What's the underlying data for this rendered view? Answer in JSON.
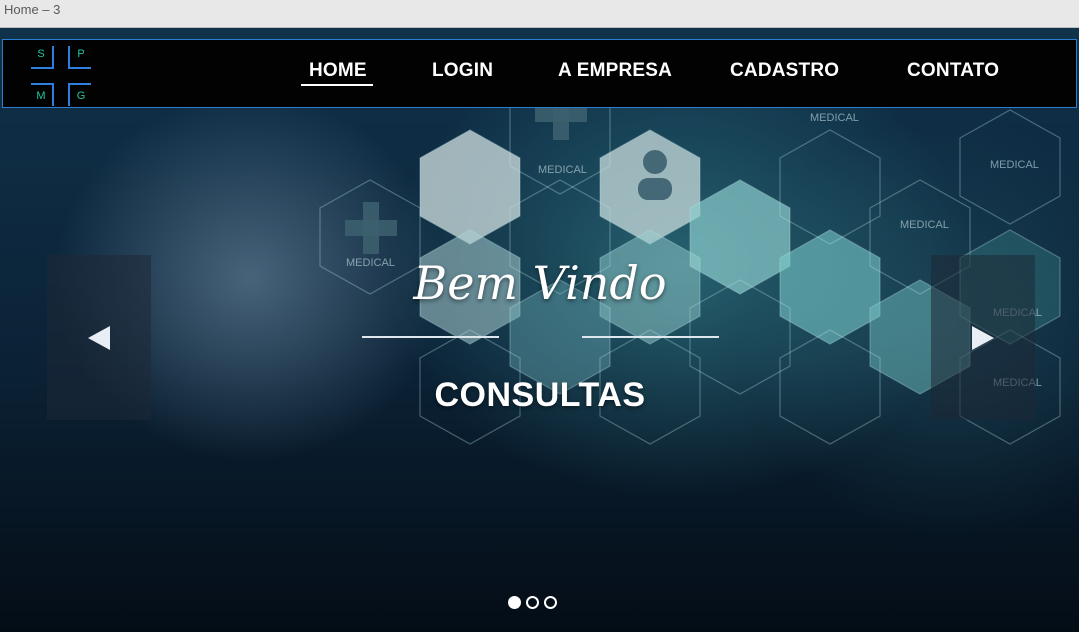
{
  "window": {
    "title": "Home – 3"
  },
  "logo": {
    "letters": [
      "S",
      "P",
      "M",
      "G"
    ]
  },
  "nav": {
    "items": [
      {
        "label": "HOME",
        "active": true
      },
      {
        "label": "LOGIN",
        "active": false
      },
      {
        "label": "A EMPRESA",
        "active": false
      },
      {
        "label": "CADASTRO",
        "active": false
      },
      {
        "label": "CONTATO",
        "active": false
      }
    ]
  },
  "hero": {
    "welcome": "Bem Vindo",
    "headline": "CONSULTAS",
    "background_labels": [
      "MEDICAL",
      "MEDICAL",
      "MEDICAL",
      "MEDICAL",
      "MEDICAL",
      "MEDICAL",
      "MEDICAL"
    ]
  },
  "carousel": {
    "prev_icon": "chevron-left-icon",
    "next_icon": "chevron-right-icon",
    "slide_count": 3,
    "active_slide": 1
  },
  "colors": {
    "nav_bg": "#020202",
    "nav_border": "#2b7fd0",
    "logo_text": "#23c6a0",
    "logo_lines": "#2f7fe0"
  }
}
